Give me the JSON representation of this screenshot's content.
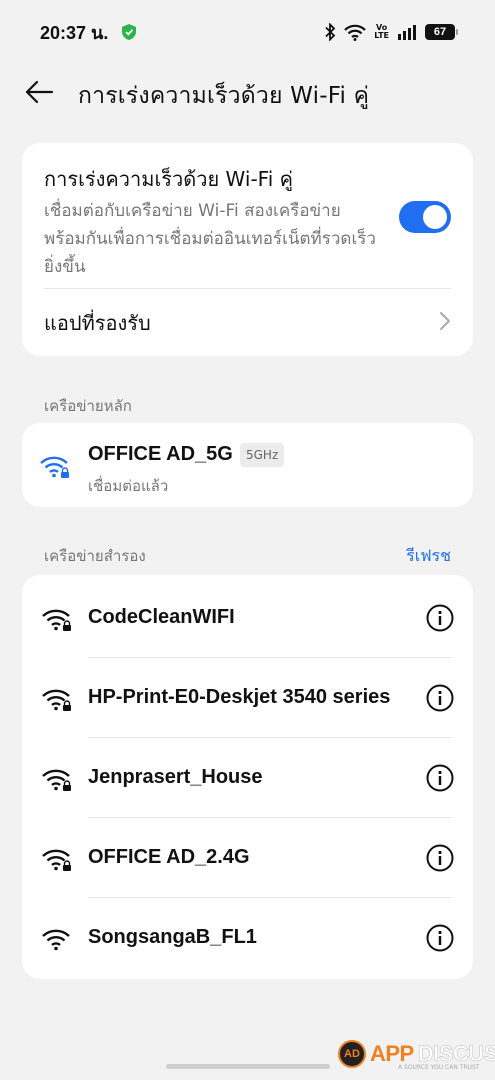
{
  "status_bar": {
    "time": "20:37 น.",
    "battery": "67",
    "volte_top": "Vo",
    "volte_bottom": "LTE",
    "icons": [
      "shield-icon",
      "bluetooth-icon",
      "wifi-icon",
      "signal-icon",
      "battery-icon"
    ]
  },
  "header": {
    "title": "การเร่งความเร็วด้วย Wi-Fi คู่",
    "back_icon": "back-arrow-icon"
  },
  "dual_wifi": {
    "title": "การเร่งความเร็วด้วย Wi-Fi คู่",
    "description": "เชื่อมต่อกับเครือข่าย Wi-Fi สองเครือข่ายพร้อมกันเพื่อการเชื่อมต่ออินเทอร์เน็ตที่รวดเร็วยิ่งขึ้น",
    "enabled": true,
    "supported_apps_label": "แอปที่รองรับ"
  },
  "primary_section": {
    "label": "เครือข่ายหลัก",
    "network": {
      "name": "OFFICE AD_5G",
      "band": "5GHz",
      "status": "เชื่อมต่อแล้ว"
    }
  },
  "backup_section": {
    "label": "เครือข่ายสำรอง",
    "refresh_label": "รีเฟรช",
    "networks": [
      {
        "name": "CodeCleanWIFI",
        "locked": true
      },
      {
        "name": "HP-Print-E0-Deskjet 3540 series",
        "locked": true
      },
      {
        "name": "Jenprasert_House",
        "locked": true
      },
      {
        "name": "OFFICE AD_2.4G",
        "locked": true
      },
      {
        "name": "SongsangaB_FL1",
        "locked": false
      }
    ]
  },
  "watermark": {
    "badge": "AD",
    "brand_a": "APP",
    "brand_b": "DISCUS",
    "tagline": "A SOURCE YOU CAN TRUST"
  },
  "colors": {
    "accent": "#1f6ff0",
    "background": "#f2f2f2",
    "card": "#ffffff",
    "secondary_text": "#777777",
    "watermark": "#f08020"
  }
}
